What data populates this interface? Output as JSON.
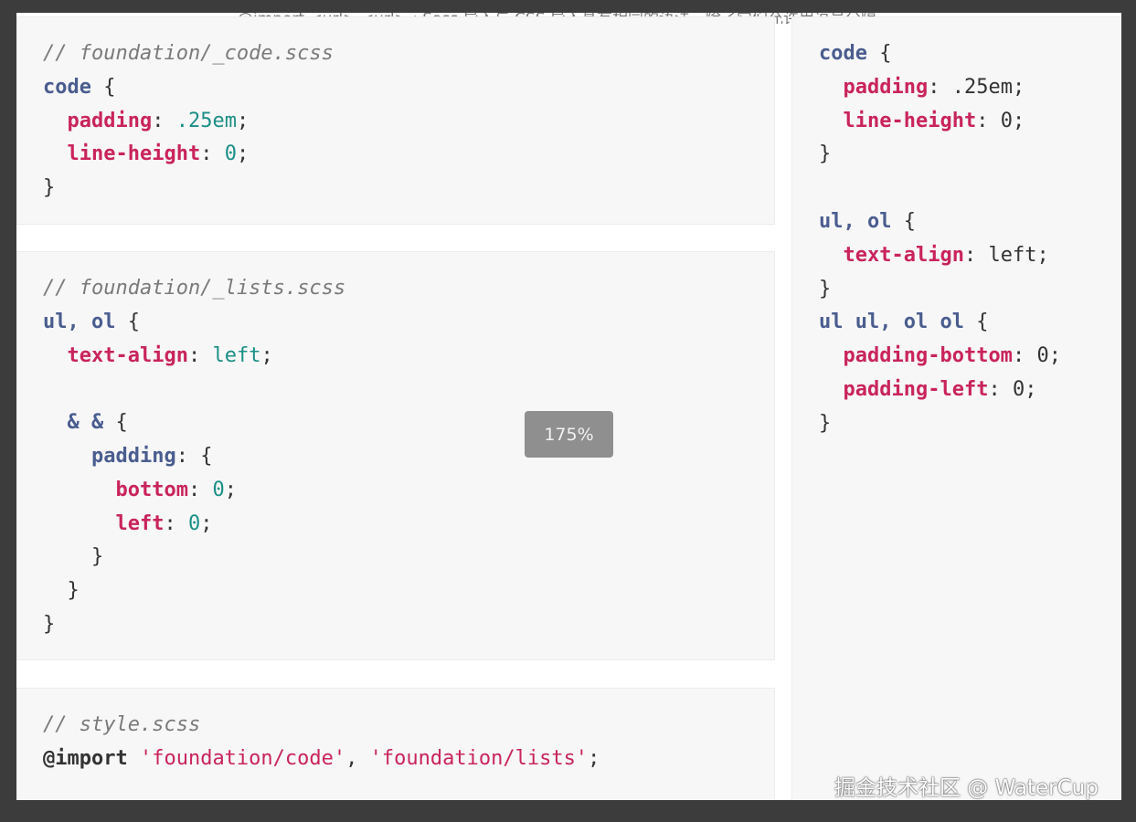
{
  "background_text": {
    "top_line": "@import  <url> <url>  ; Sass 导入与 CSS 导入具有相同的语法，除了它们允许用逗号分隔",
    "right_fragment_1": "并",
    "right_fragment_2": "on"
  },
  "panels": {
    "code_partial": {
      "comment": "// foundation/_code.scss",
      "selector": "code",
      "padding_prop": "padding",
      "padding_val": ".25em",
      "lh_prop": "line-height",
      "lh_val": "0"
    },
    "lists_partial": {
      "comment": "// foundation/_lists.scss",
      "selector": "ul, ol",
      "ta_prop": "text-align",
      "ta_val": "left",
      "nested_selector": "& &",
      "nested_prop": "padding",
      "bottom_prop": "bottom",
      "bottom_val": "0",
      "left_prop": "left",
      "left_val": "0"
    },
    "style_main": {
      "comment": "// style.scss",
      "directive": "@import",
      "arg1": "'foundation/code'",
      "arg2": "'foundation/lists'"
    },
    "css_output": {
      "sel1": "code",
      "p1_prop": "padding",
      "p1_val": ".25em",
      "p2_prop": "line-height",
      "p2_val": "0",
      "sel2": "ul, ol",
      "p3_prop": "text-align",
      "p3_val": "left",
      "sel3": "ul ul, ol ol",
      "p4_prop": "padding-bottom",
      "p4_val": "0",
      "p5_prop": "padding-left",
      "p5_val": "0"
    }
  },
  "zoom": {
    "label": "175%"
  },
  "watermark": {
    "text": "掘金技术社区 @ WaterCup"
  }
}
